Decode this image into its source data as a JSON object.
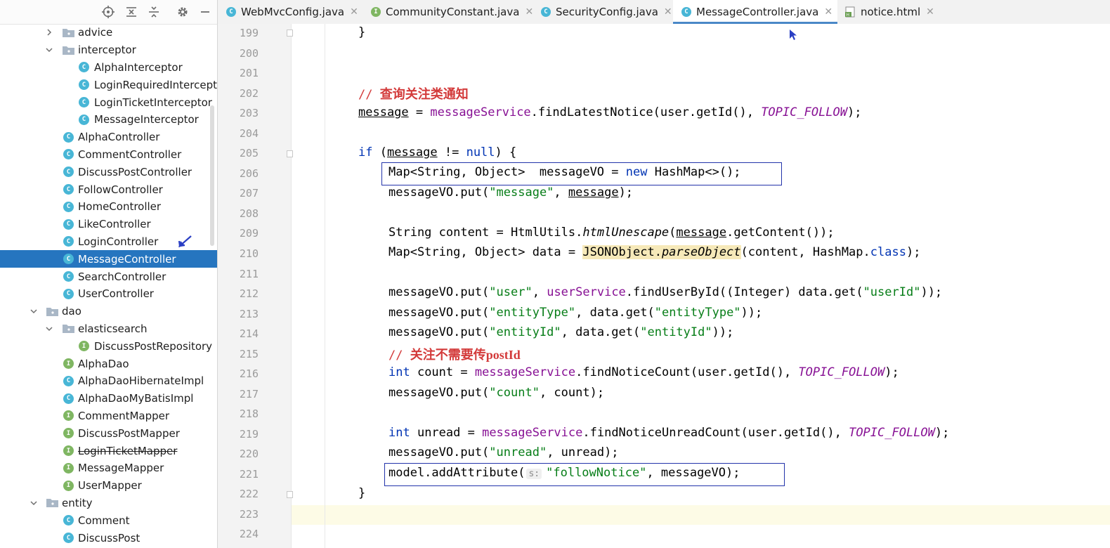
{
  "sidebar": {
    "items": [
      {
        "label": "advice",
        "type": "folder",
        "expanded": false
      },
      {
        "label": "interceptor",
        "type": "folder",
        "expanded": true
      },
      {
        "label": "AlphaInterceptor",
        "type": "class"
      },
      {
        "label": "LoginRequiredIntercept",
        "type": "class"
      },
      {
        "label": "LoginTicketInterceptor",
        "type": "class"
      },
      {
        "label": "MessageInterceptor",
        "type": "class"
      },
      {
        "label": "AlphaController",
        "type": "class"
      },
      {
        "label": "CommentController",
        "type": "class"
      },
      {
        "label": "DiscussPostController",
        "type": "class"
      },
      {
        "label": "FollowController",
        "type": "class"
      },
      {
        "label": "HomeController",
        "type": "class"
      },
      {
        "label": "LikeController",
        "type": "class"
      },
      {
        "label": "LoginController",
        "type": "class"
      },
      {
        "label": "MessageController",
        "type": "class",
        "selected": true
      },
      {
        "label": "SearchController",
        "type": "class"
      },
      {
        "label": "UserController",
        "type": "class"
      },
      {
        "label": "dao",
        "type": "folder",
        "expanded": true
      },
      {
        "label": "elasticsearch",
        "type": "folder",
        "expanded": true
      },
      {
        "label": "DiscussPostRepository",
        "type": "interface"
      },
      {
        "label": "AlphaDao",
        "type": "interface"
      },
      {
        "label": "AlphaDaoHibernateImpl",
        "type": "class"
      },
      {
        "label": "AlphaDaoMyBatisImpl",
        "type": "class"
      },
      {
        "label": "CommentMapper",
        "type": "interface"
      },
      {
        "label": "DiscussPostMapper",
        "type": "interface"
      },
      {
        "label": "LoginTicketMapper",
        "type": "interface",
        "strikethrough": true
      },
      {
        "label": "MessageMapper",
        "type": "interface"
      },
      {
        "label": "UserMapper",
        "type": "interface"
      },
      {
        "label": "entity",
        "type": "folder",
        "expanded": true
      },
      {
        "label": "Comment",
        "type": "class"
      },
      {
        "label": "DiscussPost",
        "type": "class"
      }
    ]
  },
  "tabs": [
    {
      "label": "WebMvcConfig.java",
      "icon": "class-icon",
      "active": false
    },
    {
      "label": "CommunityConstant.java",
      "icon": "interface-icon",
      "active": false
    },
    {
      "label": "SecurityConfig.java",
      "icon": "class-icon",
      "active": false
    },
    {
      "label": "MessageController.java",
      "icon": "class-icon",
      "active": true
    },
    {
      "label": "notice.html",
      "icon": "html-file-icon",
      "active": false
    }
  ],
  "editor": {
    "line_numbers": [
      "199",
      "200",
      "201",
      "202",
      "203",
      "204",
      "205",
      "206",
      "207",
      "208",
      "209",
      "210",
      "211",
      "212",
      "213",
      "214",
      "215",
      "216",
      "217",
      "218",
      "219",
      "220",
      "221",
      "222",
      "223",
      "224"
    ],
    "current_line": "223",
    "tokens": {
      "brace_close": "}",
      "cmt_slash": "// ",
      "cmt1": "查询关注类通知",
      "cmt2": "关注不需要传postId",
      "message": "message",
      "messageService": "messageService",
      "userService": "userService",
      "TOPIC_FOLLOW": "TOPIC_FOLLOW",
      "if": "if",
      "null": "null",
      "new": "new",
      "int": "int",
      "class": "class",
      "htmlUnescape": "htmlUnescape",
      "JSONObject_parse_a": "JSONObject.",
      "JSONObject_parse_b": "parseObject",
      "s_message": "\"message\"",
      "s_user": "\"user\"",
      "s_userId": "\"userId\"",
      "s_entityType": "\"entityType\"",
      "s_entityId": "\"entityId\"",
      "s_count": "\"count\"",
      "s_unread": "\"unread\"",
      "s_followNotice": "\"followNotice\"",
      "param_hint": "s:",
      "p203a": " = ",
      "p203b": ".findLatestNotice(user.getId(), ",
      "p203c": ");",
      "p205a": " (",
      "p205b": " != ",
      "p205c": ") {",
      "p206a": "Map<String, Object>  messageVO = ",
      "p206b": " HashMap<>();",
      "p207a": "messageVO.put(",
      "p207b": ", ",
      "p207c": ");",
      "p209a": "String content = HtmlUtils.",
      "p209b": "(",
      "p209c": ".getContent());",
      "p210a": "Map<String, Object> data = ",
      "p210b": "(content, HashMap.",
      "p210c": ");",
      "p212a": "messageVO.put(",
      "p212b": ", ",
      "p212c": ".findUserById((Integer) data.get(",
      "p212d": "));",
      "p213a": "messageVO.put(",
      "p213b": ", data.get(",
      "p213c": "));",
      "p216a": " count = ",
      "p216b": ".findNoticeCount(user.getId(), ",
      "p216c": ");",
      "p217a": "messageVO.put(",
      "p217b": ", count);",
      "p219a": " unread = ",
      "p219b": ".findNoticeUnreadCount(user.getId(), ",
      "p219c": ");",
      "p220a": "messageVO.put(",
      "p220b": ", unread);",
      "p221a": "model.addAttribute(",
      "p221b": ", messageVO);"
    }
  },
  "colors": {
    "selection": "#2675bf",
    "keyword": "#0033b3",
    "string": "#067d17",
    "field": "#871094",
    "comment": "#d33a3a",
    "annotation_box": "#2233aa",
    "class_badge": "#48b6d6",
    "interface_badge": "#7fb662"
  }
}
